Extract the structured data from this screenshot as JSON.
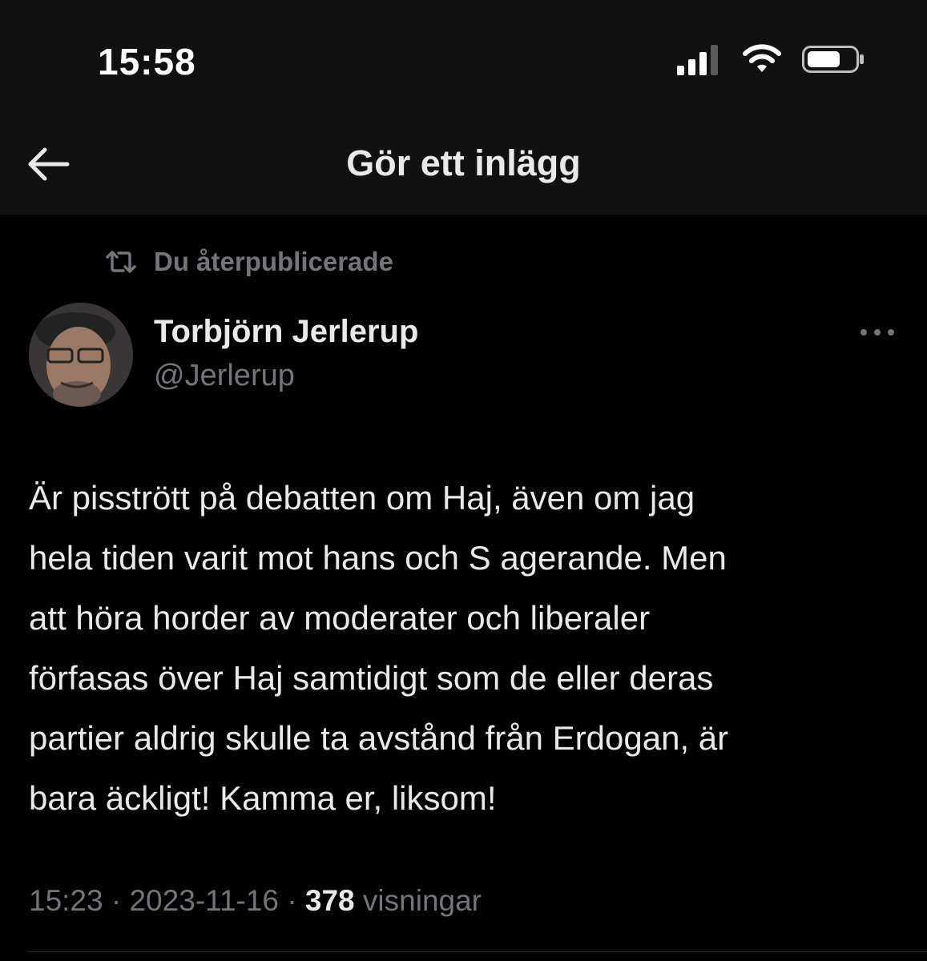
{
  "status_bar": {
    "time": "15:58",
    "icons": [
      "cellular-signal-icon",
      "wifi-icon",
      "battery-icon"
    ]
  },
  "nav": {
    "back_icon": "arrow-left-icon",
    "title": "Gör ett inlägg"
  },
  "post": {
    "repost_icon": "repost-icon",
    "repost_label": "Du återpublicerade",
    "author": {
      "name": "Torbjörn Jerlerup",
      "handle": "@Jerlerup"
    },
    "more_icon": "more-options-icon",
    "text": "Är pisstrött på debatten om Haj, även om jag\nhela tiden varit mot hans och S agerande. Men\natt höra horder av moderater och liberaler\nförfasas över Haj samtidigt som de eller deras\npartier aldrig skulle ta avstånd från Erdogan, är\nbara äckligt! Kamma er, liksom!",
    "time": "15:23",
    "separator": "·",
    "date": "2023-11-16",
    "views_count": "378",
    "views_label": "visningar"
  },
  "colors": {
    "background": "#000000",
    "topbar": "#111111",
    "text_primary": "#e7e9ea",
    "text_secondary": "#71767b"
  }
}
